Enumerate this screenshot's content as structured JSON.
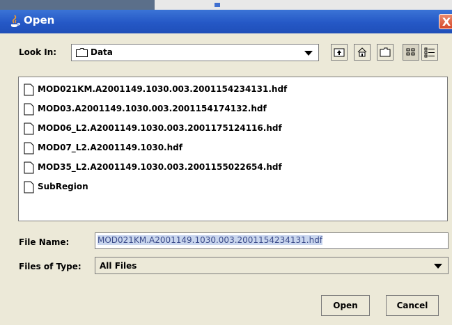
{
  "window": {
    "title": "Open",
    "close_glyph": "X"
  },
  "lookin": {
    "label": "Look In:",
    "value": "Data"
  },
  "toolbar": [
    {
      "name": "up-one-level-icon"
    },
    {
      "name": "home-icon"
    },
    {
      "name": "new-folder-icon"
    },
    {
      "name": "list-view-icon"
    },
    {
      "name": "details-view-icon"
    }
  ],
  "files": [
    "MOD021KM.A2001149.1030.003.2001154234131.hdf",
    "MOD03.A2001149.1030.003.2001154174132.hdf",
    "MOD06_L2.A2001149.1030.003.2001175124116.hdf",
    "MOD07_L2.A2001149.1030.hdf",
    "MOD35_L2.A2001149.1030.003.2001155022654.hdf",
    "SubRegion"
  ],
  "filename": {
    "label": "File Name:",
    "value": "MOD021KM.A2001149.1030.003.2001154234131.hdf"
  },
  "filetype": {
    "label": "Files of Type:",
    "value": "All Files"
  },
  "buttons": {
    "open": "Open",
    "cancel": "Cancel"
  },
  "colors": {
    "titlebar": "#2558c6",
    "selection": "#c9d6ee"
  }
}
